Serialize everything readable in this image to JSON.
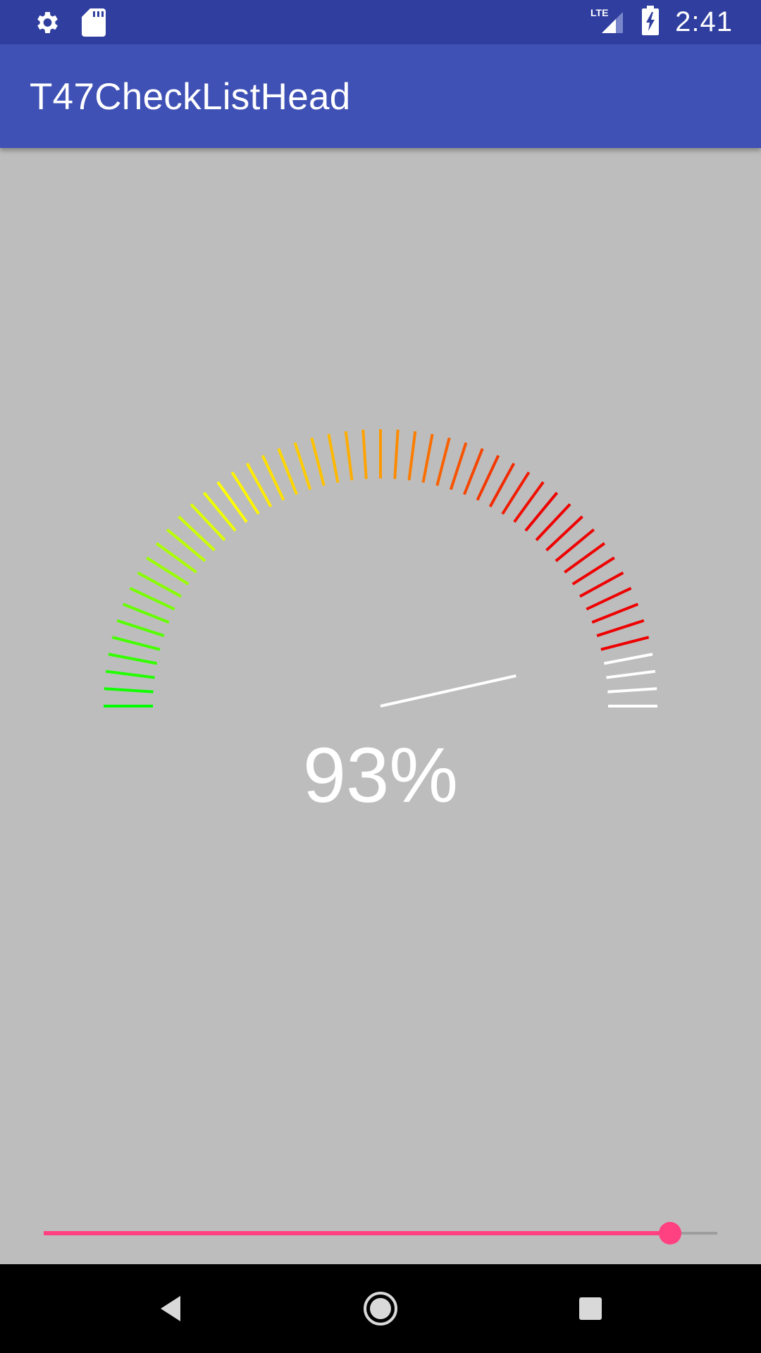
{
  "status_bar": {
    "time": "2:41",
    "network_label": "LTE",
    "icons": [
      "settings-icon",
      "sd-card-icon",
      "lte-signal-icon",
      "battery-charging-icon"
    ]
  },
  "app_bar": {
    "title": "T47CheckListHead"
  },
  "gauge": {
    "value_percent": 93,
    "display_text": "93%",
    "tick_count": 51,
    "colors": {
      "low": "#00ff00",
      "mid": "#ffff00",
      "upper": "#ff9900",
      "high": "#ee0000",
      "inactive": "#ffffff",
      "needle": "#ffffff"
    }
  },
  "seekbar": {
    "progress_fraction": 0.93,
    "accent_color": "#ff4081"
  },
  "nav_bar": {
    "buttons": [
      "back-icon",
      "home-icon",
      "recents-icon"
    ]
  }
}
